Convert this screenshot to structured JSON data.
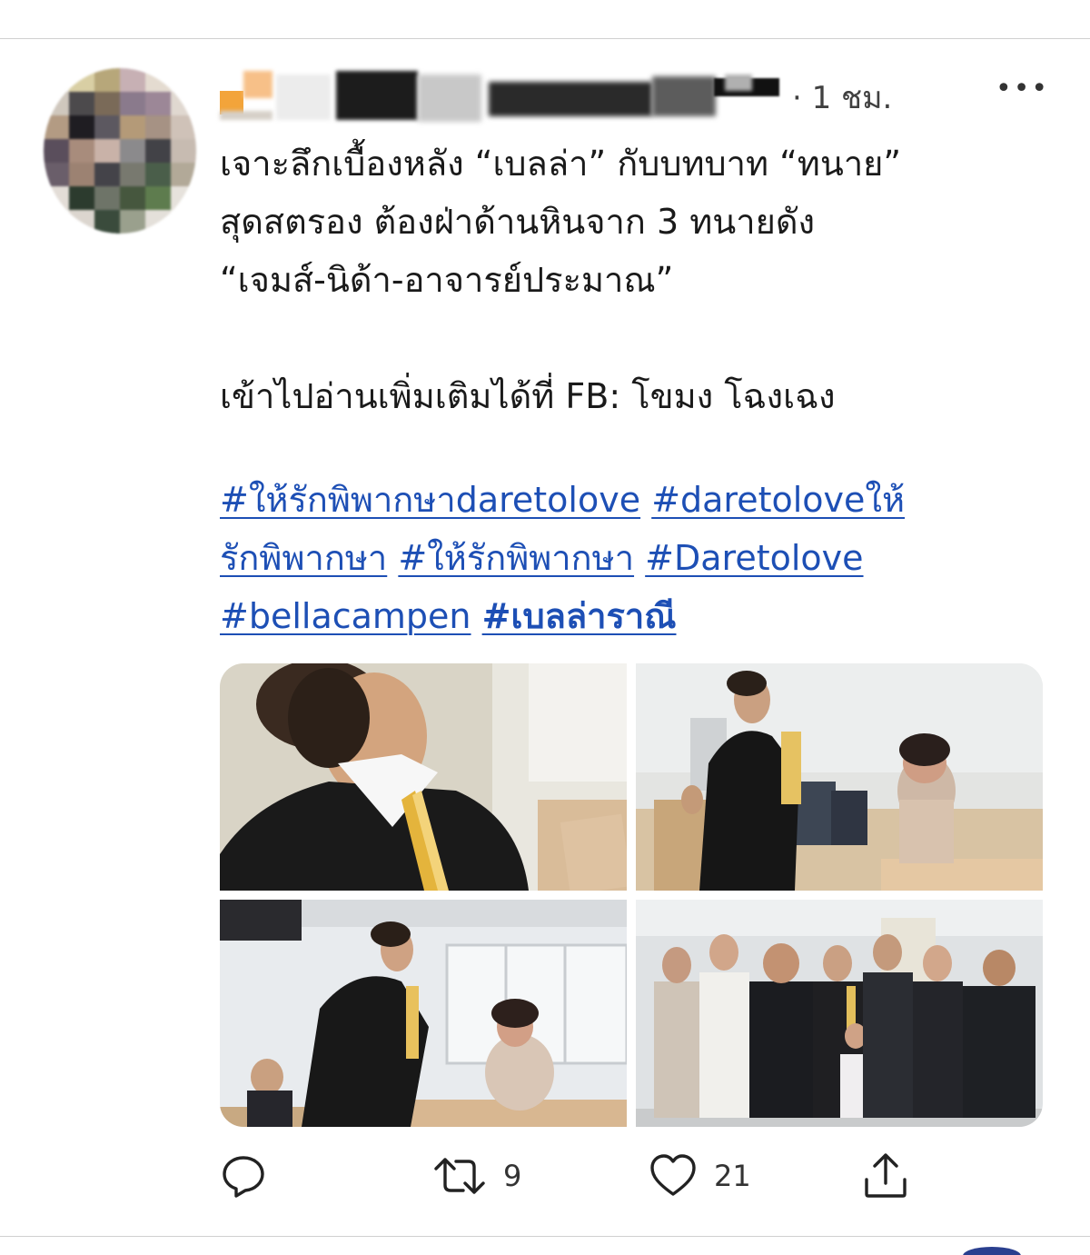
{
  "tweet": {
    "time": "· 1 ชม.",
    "more_label": "•••",
    "text_lines": [
      "เจาะลึกเบื้องหลัง “เบลล่า” กับบทบาท “ทนาย”",
      "สุดสตรอง ต้องฝ่าด้านหินจาก 3 ทนายดัง",
      "“เจมส์-นิด้า-อาจารย์ประมาณ”"
    ],
    "read_more": "เข้าไปอ่านเพิ่มเติมได้ที่ FB: โขมง โฉงเฉง",
    "hashtags": [
      "#ให้รักพิพากษาdaretolove",
      "#daretoloveให้",
      "รักพิพากษา",
      "#ให้รักพิพากษา",
      "#Daretolove",
      "#bellacampen",
      "#เบลล่าราณี"
    ]
  },
  "media": {
    "photos": [
      {
        "name": "photo-1",
        "icon": "photo-lawyer-closeup"
      },
      {
        "name": "photo-2",
        "icon": "photo-courtroom-standing"
      },
      {
        "name": "photo-3",
        "icon": "photo-courtroom-leaning"
      },
      {
        "name": "photo-4",
        "icon": "photo-group-cast"
      }
    ]
  },
  "actions": {
    "reply_count": "",
    "retweet_count": "9",
    "like_count": "21"
  },
  "colors": {
    "link": "#1d4fb5",
    "text": "#1a1a1a",
    "divider": "#d0d0d0"
  }
}
